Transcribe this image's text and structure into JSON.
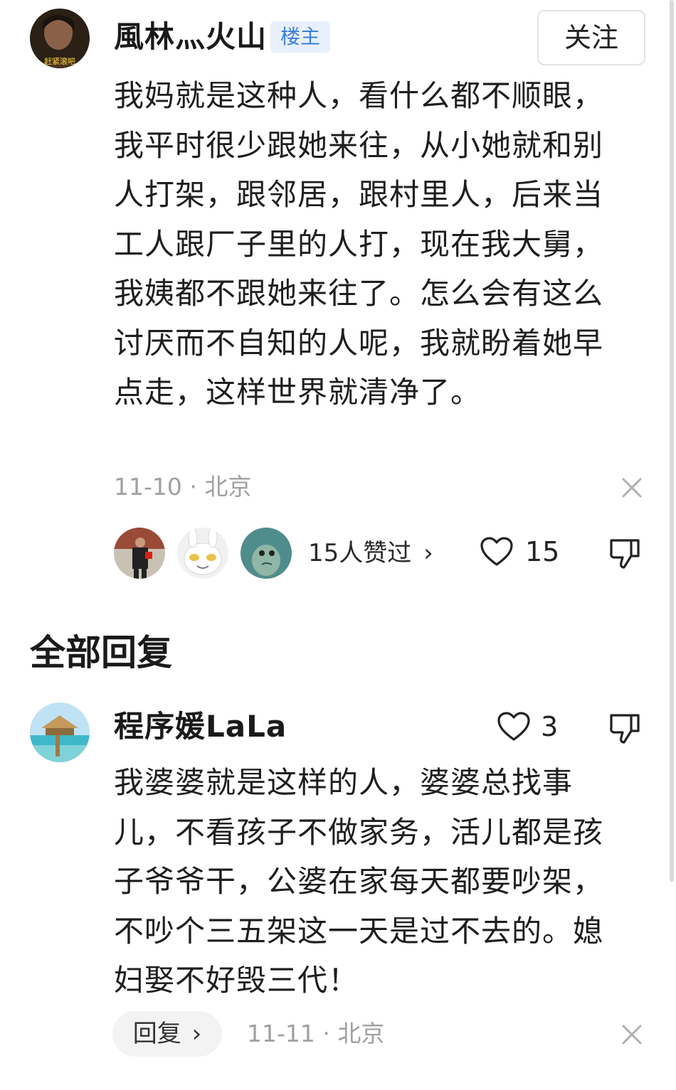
{
  "post": {
    "author": "風林灬火山",
    "author_avatar_caption": "赶紧滚吧",
    "badge": "楼主",
    "follow_label": "关注",
    "content": "我妈就是这种人，看什么都不顺眼，我平时很少跟她来往，从小她就和别人打架，跟邻居，跟村里人，后来当工人跟厂子里的人打，现在我大舅，我姨都不跟她来往了。怎么会有这么讨厌而不自知的人呢，我就盼着她早点走，这样世界就清净了。",
    "date": "11-10",
    "location": "北京",
    "likers_text": "15人赞过",
    "likers_chevron": "›",
    "like_count": "15"
  },
  "section": {
    "title": "全部回复"
  },
  "reply": {
    "author": "程序媛LaLa",
    "like_count": "3",
    "content": "我婆婆就是这样的人，婆婆总找事儿，不看孩子不做家务，活儿都是孩子爷爷干，公婆在家每天都要吵架，不吵个三五架这一天是过不去的。媳妇娶不好毁三代！",
    "reply_button_label": "回复",
    "reply_chevron": "›",
    "date": "11-11",
    "location": "北京"
  },
  "meta_separator": "·",
  "icons": {
    "like": "heart-outline-icon",
    "dislike": "thumbs-down-outline-icon",
    "close": "close-icon"
  },
  "colors": {
    "badge_bg": "#e8f0fb",
    "badge_text": "#3a7fd6",
    "meta": "#a0a0a0"
  }
}
